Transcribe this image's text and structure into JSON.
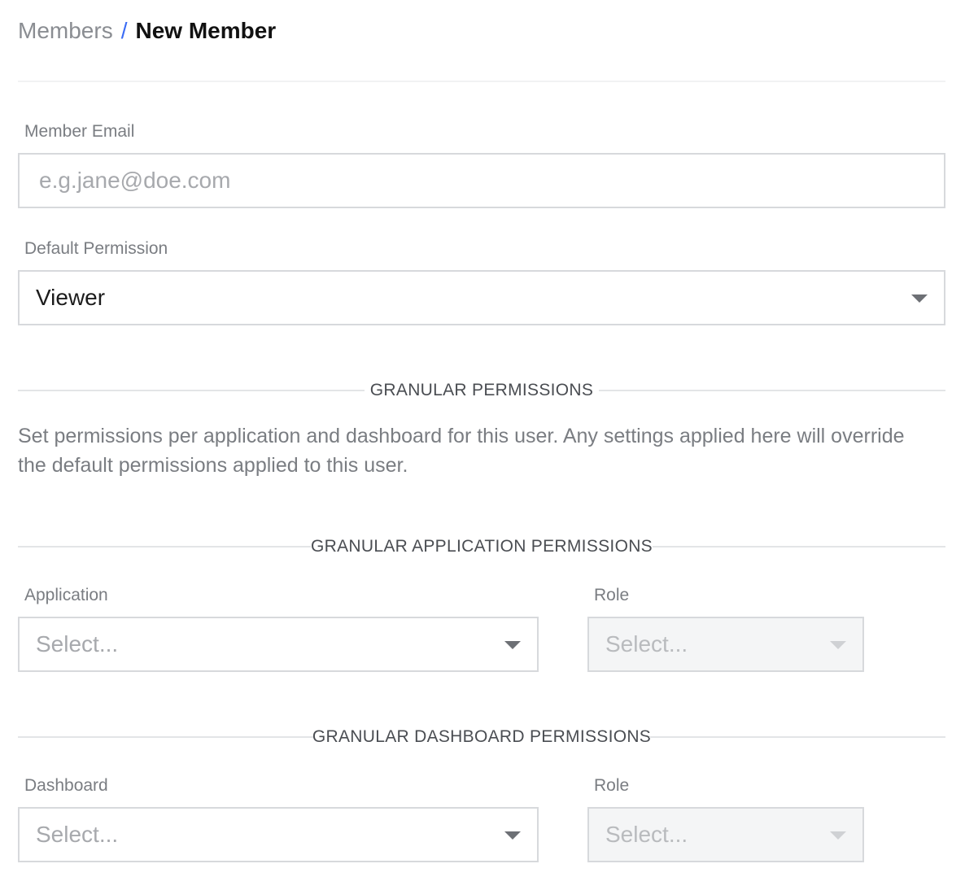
{
  "breadcrumb": {
    "parent": "Members",
    "separator": "/",
    "current": "New Member"
  },
  "member_email": {
    "label": "Member Email",
    "value": "",
    "placeholder": "e.g.jane@doe.com"
  },
  "default_permission": {
    "label": "Default Permission",
    "value": "Viewer",
    "icon": "chevron-down-icon"
  },
  "granular": {
    "title": "GRANULAR PERMISSIONS",
    "description": "Set permissions per application and dashboard for this user. Any settings applied here will override the default permissions applied to this user."
  },
  "application_permissions": {
    "title": "GRANULAR APPLICATION PERMISSIONS",
    "application_label": "Application",
    "application_placeholder": "Select...",
    "role_label": "Role",
    "role_placeholder": "Select...",
    "role_disabled": true
  },
  "dashboard_permissions": {
    "title": "GRANULAR DASHBOARD PERMISSIONS",
    "dashboard_label": "Dashboard",
    "dashboard_placeholder": "Select...",
    "role_label": "Role",
    "role_placeholder": "Select...",
    "role_disabled": true
  },
  "colors": {
    "accent": "#3b6cf5",
    "border": "#d7d9dc",
    "muted_text": "#7a7d82",
    "placeholder_text": "#a7a9ad",
    "disabled_bg": "#f4f5f6"
  }
}
